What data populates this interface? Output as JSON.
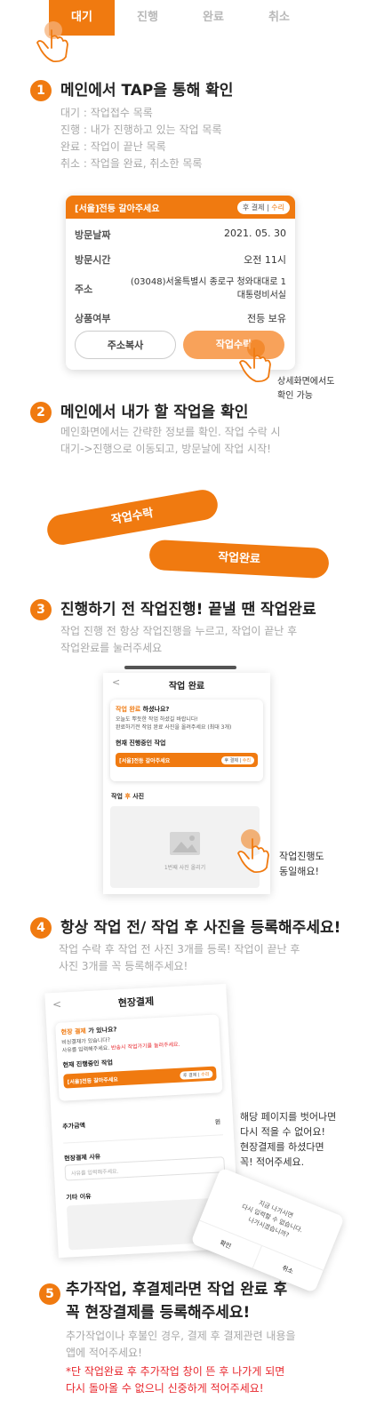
{
  "tabs": [
    "대기",
    "진행",
    "완료",
    "취소"
  ],
  "step1": {
    "num": "1",
    "title": "메인에서 TAP을 통해 확인",
    "lines": [
      "대기 : 작업접수 목록",
      "진행 : 내가 진행하고 있는 작업 목록",
      "완료 : 작업이 끝난 목록",
      "취소 : 작업을 완료, 취소한 목록"
    ]
  },
  "card": {
    "title": "[서울]전등 갈아주세요",
    "badge_a": "후 결제",
    "badge_b": "수리",
    "rows": [
      {
        "k": "방문날짜",
        "v": "2021. 05. 30"
      },
      {
        "k": "방문시간",
        "v": "오전 11시"
      },
      {
        "k": "주소",
        "v1": "(03048)서울특별시 종로구 청와대대로 1",
        "v2": "대통령비서실"
      },
      {
        "k": "상품여부",
        "v": "전등 보유"
      }
    ],
    "btn_copy": "주소복사",
    "btn_accept": "작업수락",
    "note": [
      "상세화면에서도",
      "확인 가능"
    ]
  },
  "step2": {
    "num": "2",
    "title": "메인에서 내가 할 작업을 확인",
    "lines": [
      "메인화면에서는 간략한 정보를 확인. 작업 수락 시",
      "대기->진행으로 이동되고, 방문날에 작업 시작!"
    ]
  },
  "pills": {
    "accept": "작업수락",
    "done": "작업완료"
  },
  "step3": {
    "num": "3",
    "title": "진행하기 전 작업진행! 끝낼 땐 작업완료",
    "lines": [
      "작업 진행 전 항상 작업진행을 누르고, 작업이 끝난 후",
      "작업완료를 눌러주세요"
    ]
  },
  "screen3": {
    "back": "<",
    "title": "작업 완료",
    "q_a": "작업 완료",
    "q_b": " 하셨나요?",
    "sub1": "오늘도 뿌듯한 작업 하셨길 바랍니다!",
    "sub2": "완료하기전 작업 완료 사진을 올려주세요 (최대 3개)",
    "current": "현재 진행중인 작업",
    "job": "[서울]전등 갈아주세요",
    "badge_a": "후 결제",
    "badge_b": "수리",
    "photo_label_a": "작업 ",
    "photo_label_b": "후",
    "photo_label_c": " 사진",
    "upload": "1번째 사진 올리기",
    "note": [
      "작업진행도",
      "동일해요!"
    ]
  },
  "step4": {
    "num": "4",
    "title": "항상 작업 전/ 작업 후 사진을 등록해주세요!",
    "lines": [
      "작업 수락 후 작업 전 사진 3개를 등록! 작업이 끝난 후",
      "사진 3개를 꼭 등록해주세요!"
    ]
  },
  "screen4": {
    "back": "<",
    "title": "현장결제",
    "q_a": "현장 결제",
    "q_b": " 가 있나요?",
    "sub1": "비싱결재가 있습니다?",
    "sub2a": "사유를 입력해주세요. ",
    "sub2b": "반송시 작업가기를 눌러주세요.",
    "current": "현재 진행중인 작업",
    "job": "[서울]전등 갈아주세요",
    "badge_a": "후 결제",
    "badge_b": "수리",
    "amount_label": "추가금액",
    "amount_unit": "원",
    "reason_label": "현장결제 사유",
    "reason_placeholder": "사유를 입력해주세요.",
    "etc_label": "기타 이유",
    "popup": [
      "지금 나가시면",
      "다시 입력할 수 없습니다.",
      "나가시겠습니까?"
    ],
    "popup_ok": "확인",
    "popup_cancel": "취소",
    "note": [
      "해당 페이지를 벗어나면",
      "다시 적을 수 없어요!",
      "현장결제를 하셨다면",
      "꼭! 적어주세요."
    ]
  },
  "step5": {
    "num": "5",
    "title1": "추가작업, 후결제라면 작업 완료 후",
    "title2": "꼭 현장결제를 등록해주세요!",
    "lines": [
      "추가작업이나 후불인 경우, 결제 후 결제관련 내용을",
      "앱에 적어주세요!"
    ],
    "warn": [
      "*단 작업완료 후 추가작업 창이 뜬 후 나가게 되면",
      "다시 돌아올 수 없으니 신중하게 적어주세요!"
    ]
  },
  "colors": {
    "accent": "#f07a10",
    "accent_light": "#f8a25a",
    "muted": "#a8a8a8",
    "warn": "#e8262c"
  }
}
